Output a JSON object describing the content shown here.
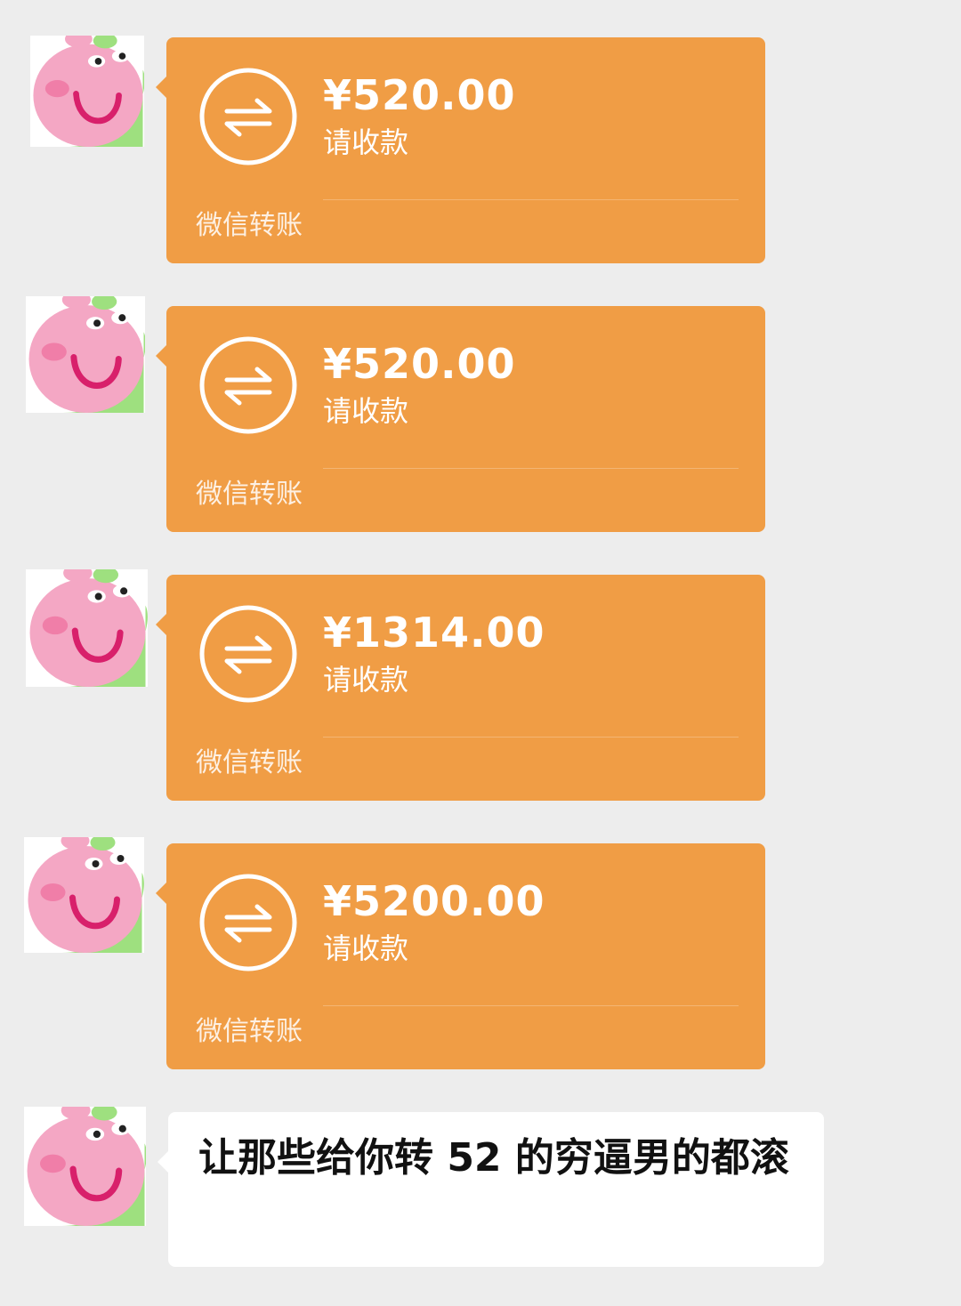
{
  "colors": {
    "background": "#ededed",
    "transfer_card": "#f09d45",
    "text_bubble": "#ffffff",
    "avatar_face": "#f4a7c4",
    "avatar_green": "#9ee07f",
    "avatar_mouth": "#d8206b"
  },
  "messages": [
    {
      "type": "transfer",
      "avatar_icon": "peppa-pig-avatar-icon",
      "icon": "transfer-arrows-icon",
      "amount": "¥520.00",
      "status": "请收款",
      "footer": "微信转账"
    },
    {
      "type": "transfer",
      "avatar_icon": "peppa-pig-avatar-icon",
      "icon": "transfer-arrows-icon",
      "amount": "¥520.00",
      "status": "请收款",
      "footer": "微信转账"
    },
    {
      "type": "transfer",
      "avatar_icon": "peppa-pig-avatar-icon",
      "icon": "transfer-arrows-icon",
      "amount": "¥1314.00",
      "status": "请收款",
      "footer": "微信转账"
    },
    {
      "type": "transfer",
      "avatar_icon": "peppa-pig-avatar-icon",
      "icon": "transfer-arrows-icon",
      "amount": "¥5200.00",
      "status": "请收款",
      "footer": "微信转账"
    },
    {
      "type": "text",
      "avatar_icon": "peppa-pig-avatar-icon",
      "text": "让那些给你转 52 的穷逼男的都滚"
    }
  ]
}
